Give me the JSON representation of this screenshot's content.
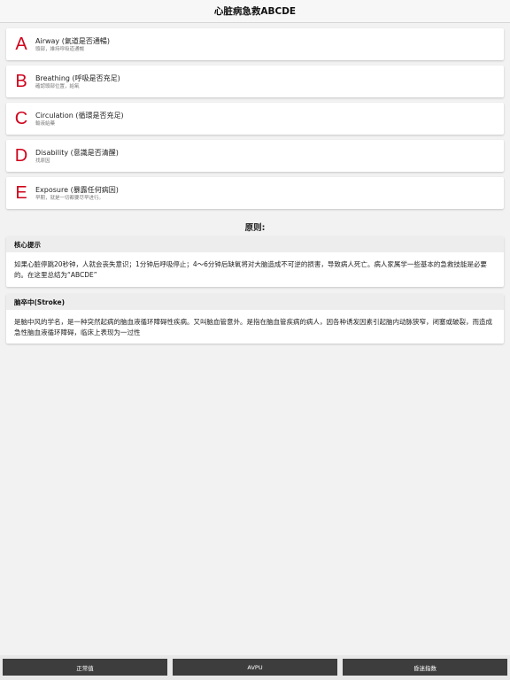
{
  "nav": {
    "title": "心脏病急救ABCDE"
  },
  "steps": [
    {
      "letter": "A",
      "title": "Airway (氣道是否通暢)",
      "subtitle": "頭部，維持呼吸道通暢"
    },
    {
      "letter": "B",
      "title": "Breathing (呼吸是否充足)",
      "subtitle": "確認頭部位置，給氧"
    },
    {
      "letter": "C",
      "title": "Circulation (循環是否充足)",
      "subtitle": "輸液給藥"
    },
    {
      "letter": "D",
      "title": "Disability (意識是否清醒)",
      "subtitle": "找原因"
    },
    {
      "letter": "E",
      "title": "Exposure (暴露任何病因)",
      "subtitle": "早期，就是一切都要尽早进行。"
    }
  ],
  "principles": {
    "heading": "原则:",
    "cards": [
      {
        "title": "核心提示",
        "body": "如果心脏停跳20秒钟，人就会丧失意识；1分钟后呼吸停止；4～6分钟后缺氧将对大脑造成不可逆的损害，导致病人死亡。病人家属学一些基本的急救技能是必要的。在这里总结为“ABCDE”"
      },
      {
        "title": "脑卒中(Stroke)",
        "body": "是脑中风的学名，是一种突然起病的脑血液循环障碍性疾病。又叫脑血管意外。是指在脑血管疾病的病人，因各种诱发因素引起脑内动脉狭窄，闭塞或破裂，而造成急性脑血液循环障碍，临床上表现为一过性"
      }
    ]
  },
  "toolbar": {
    "buttons": [
      "正常值",
      "AVPU",
      "昏迷指数"
    ]
  },
  "colors": {
    "accent_letter": "#d0021b",
    "toolbar_button": "#3d3d3d",
    "background": "#f2f2f2"
  }
}
